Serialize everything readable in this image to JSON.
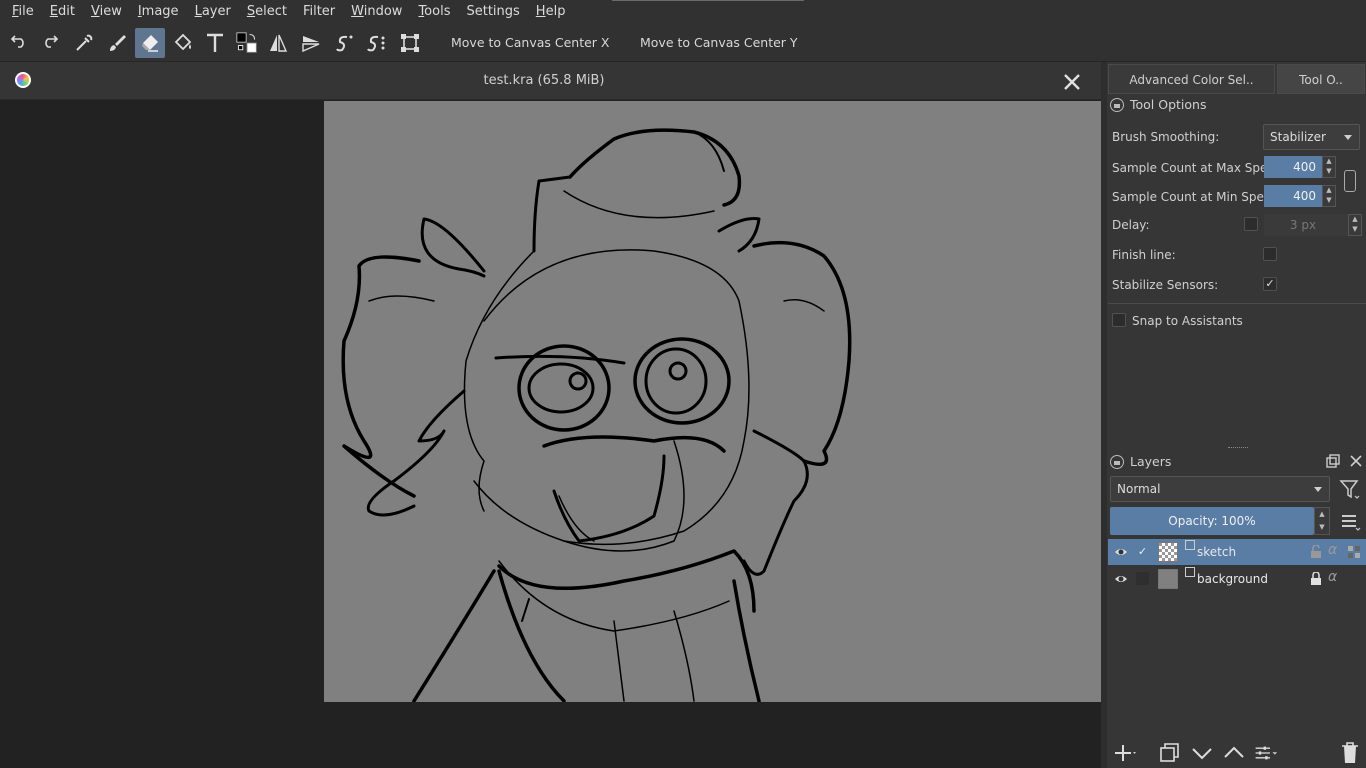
{
  "menubar": {
    "items": [
      {
        "label": "File",
        "u": "F",
        "rest": "ile"
      },
      {
        "label": "Edit",
        "u": "E",
        "rest": "dit"
      },
      {
        "label": "View",
        "u": "V",
        "rest": "iew"
      },
      {
        "label": "Image",
        "u": "I",
        "rest": "mage"
      },
      {
        "label": "Layer",
        "u": "L",
        "rest": "ayer"
      },
      {
        "label": "Select",
        "u": "S",
        "rest": "elect"
      },
      {
        "label": "Filter",
        "u": "",
        "rest": "Filter"
      },
      {
        "label": "Window",
        "u": "W",
        "rest": "indow"
      },
      {
        "label": "Tools",
        "u": "T",
        "rest": "ools"
      },
      {
        "label": "Settings",
        "u": "",
        "rest": "Settings"
      },
      {
        "label": "Help",
        "u": "H",
        "rest": "elp"
      }
    ]
  },
  "toolbar": {
    "tools": [
      "undo-icon",
      "redo-icon",
      "eyedropper-icon",
      "brush-icon",
      "eraser-icon",
      "fill-icon",
      "text-icon",
      "color-swap-icon",
      "mirror-x-icon",
      "mirror-y-icon",
      "smoothing-icon",
      "symmetry-icon",
      "transform-icon"
    ],
    "active_tool": "eraser-icon",
    "move_center_x": "Move to Canvas Center X",
    "move_center_y": "Move to Canvas Center Y"
  },
  "document": {
    "title": "test.kra (65.8 MiB)"
  },
  "right_panel": {
    "tab_color": "Advanced Color Sel..",
    "tab_tool": "Tool O..",
    "tool_options_title": "Tool Options",
    "brush_smoothing_label": "Brush Smoothing:",
    "brush_smoothing_value": "Stabilizer",
    "sample_max_label": "Sample Count at Max Speed:",
    "sample_max_value": "400",
    "sample_min_label": "Sample Count at Min Speed:",
    "sample_min_value": "400",
    "delay_label": "Delay:",
    "delay_value": "3 px",
    "delay_checked": false,
    "finish_line_label": "Finish line:",
    "finish_line_checked": false,
    "stabilize_sensors_label": "Stabilize Sensors:",
    "stabilize_sensors_checked": true,
    "snap_label": "Snap to Assistants",
    "snap_checked": false
  },
  "layers": {
    "title": "Layers",
    "blend_mode": "Normal",
    "opacity": "Opacity:  100%",
    "items": [
      {
        "name": "sketch",
        "selected": true,
        "checked": true
      },
      {
        "name": "background",
        "selected": false,
        "checked": false,
        "locked": true
      }
    ]
  },
  "colors": {
    "accent": "#5a7da6",
    "canvas": "#808080",
    "background": "#222222"
  }
}
